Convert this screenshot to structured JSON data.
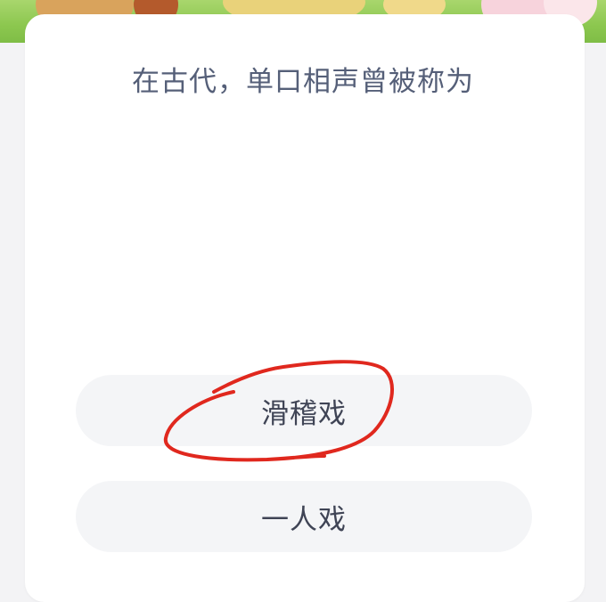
{
  "question": {
    "text": "在古代，单口相声曾被称为"
  },
  "options": [
    {
      "label": "滑稽戏"
    },
    {
      "label": "一人戏"
    }
  ],
  "colors": {
    "banner_green": "#8cc74f",
    "card_background": "#ffffff",
    "option_background": "#f4f5f7",
    "question_text": "#555f78",
    "annotation_red": "#e0281e"
  },
  "annotation": {
    "type": "hand-drawn-circle",
    "circled_option": "滑稽戏"
  }
}
